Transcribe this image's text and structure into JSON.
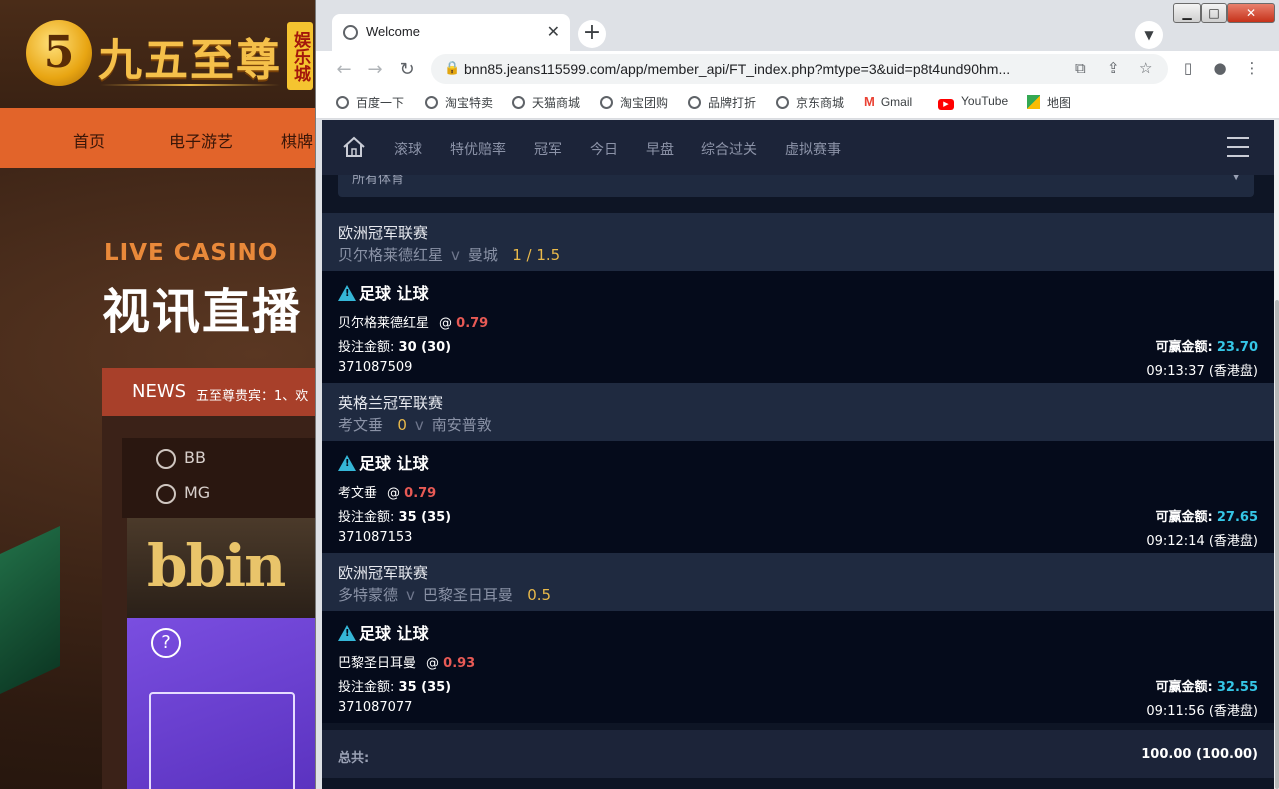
{
  "background_site": {
    "logo_mark": "5",
    "logo_text": "九五至尊",
    "logo_badge": "娱乐城",
    "nav": [
      "首页",
      "电子游艺",
      "棋牌"
    ],
    "live_title": "LIVE CASINO",
    "live_title_cn": "视讯直播",
    "news_label": "NEWS",
    "news_text": "五至尊贵宾：1、欢",
    "tabs": [
      "BB",
      "MG"
    ],
    "bbin_logo": "bbin",
    "help_icon": "?"
  },
  "browser": {
    "tab_title": "Welcome",
    "url": "bnn85.jeans115599.com/app/member_api/FT_index.php?mtype=3&uid=p8t4und90hm...",
    "bookmarks": [
      "百度一下",
      "淘宝特卖",
      "天猫商城",
      "淘宝团购",
      "品牌打折",
      "京东商城",
      "Gmail",
      "YouTube",
      "地图"
    ]
  },
  "page": {
    "nav": [
      "滚球",
      "特优赔率",
      "冠军",
      "今日",
      "早盘",
      "综合过关",
      "虚拟赛事"
    ],
    "sport_select": "所有体育",
    "bets": [
      {
        "league": "欧洲冠军联赛",
        "home": "贝尔格莱德红星",
        "away": "曼城",
        "line": "1 / 1.5",
        "type": "足球 让球",
        "pick": "贝尔格莱德红星",
        "odds": "0.79",
        "stake_label": "投注金额:",
        "stake": "30 (30)",
        "win_label": "可赢金额:",
        "win": "23.70",
        "id": "371087509",
        "time": "09:13:37 (香港盘)"
      },
      {
        "league": "英格兰冠军联赛",
        "home": "考文垂",
        "away": "南安普敦",
        "line": "0",
        "type": "足球 让球",
        "pick": "考文垂",
        "odds": "0.79",
        "stake_label": "投注金额:",
        "stake": "35 (35)",
        "win_label": "可赢金额:",
        "win": "27.65",
        "id": "371087153",
        "time": "09:12:14 (香港盘)"
      },
      {
        "league": "欧洲冠军联赛",
        "home": "多特蒙德",
        "away": "巴黎圣日耳曼",
        "line": "0.5",
        "type": "足球 让球",
        "pick": "巴黎圣日耳曼",
        "odds": "0.93",
        "stake_label": "投注金额:",
        "stake": "35 (35)",
        "win_label": "可赢金额:",
        "win": "32.55",
        "id": "371087077",
        "time": "09:11:56 (香港盘)"
      }
    ],
    "vs": "v",
    "at": "@",
    "total_label": "总共:",
    "total_value": "100.00 (100.00)"
  },
  "colors": {
    "page_bg": "#0e1525",
    "league_bg": "#1f2a40",
    "bet_bg": "#050b1b",
    "odds": "#e85a55",
    "win": "#35c6e6",
    "line": "#e9b94a"
  }
}
